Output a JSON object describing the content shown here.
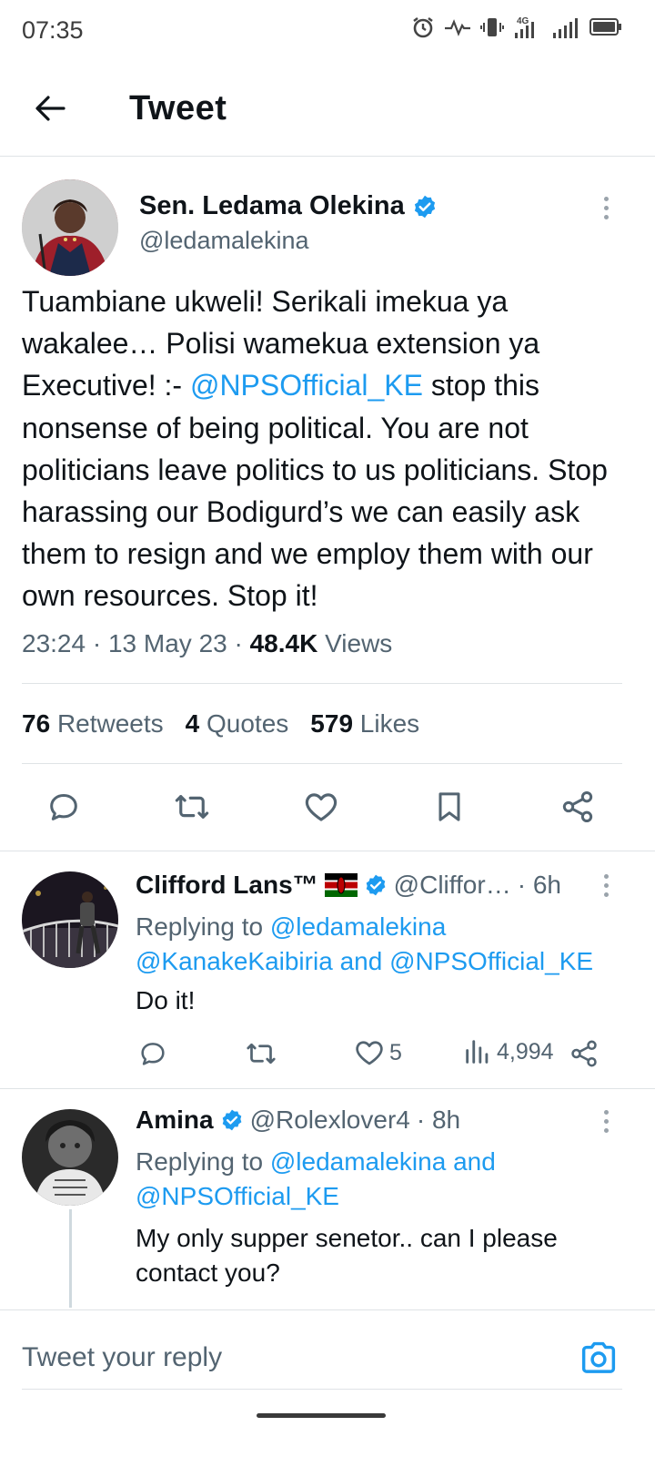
{
  "status_bar": {
    "time": "07:35",
    "network": "4G"
  },
  "header": {
    "title": "Tweet"
  },
  "main_tweet": {
    "display_name": "Sen. Ledama Olekina",
    "handle": "@ledamalekina",
    "text_1": "Tuambiane ukweli! Serikali imekua ya wakalee… Polisi wamekua extension ya Executive! :- ",
    "mention": "@NPSOfficial_KE",
    "text_2": " stop this nonsense of being political. You are not politicians leave politics to us politicians. Stop harassing our Bodigurd’s we can easily ask them to resign and we employ them with our own resources. Stop it!",
    "time": "23:24",
    "date": "13 May 23",
    "separator": "·",
    "views_count": "48.4K",
    "views_label": "Views",
    "retweets_count": "76",
    "retweets_label": "Retweets",
    "quotes_count": "4",
    "quotes_label": "Quotes",
    "likes_count": "579",
    "likes_label": "Likes"
  },
  "replies": [
    {
      "display_name": "Clifford Lans™",
      "flag": "Kenya flag",
      "handle": "@Cliffor…",
      "age": "· 6h",
      "replying_prefix": "Replying to",
      "reply_to_1": "@ledamalekina",
      "reply_to_2": "@KanakeKaibiria",
      "and": "and",
      "reply_to_3": "@NPSOfficial_KE",
      "text": "Do it!",
      "likes": "5",
      "views": "4,994"
    },
    {
      "display_name": "Amina",
      "handle": "@Rolexlover4",
      "age": "· 8h",
      "replying_prefix": "Replying to",
      "reply_to_1": "@ledamalekina",
      "and": "and",
      "reply_to_2": "@NPSOfficial_KE",
      "text": "My only supper senetor.. can I please contact you?"
    }
  ],
  "reply_bar": {
    "placeholder": "Tweet your reply"
  },
  "colors": {
    "accent": "#1d9bf0",
    "text": "#0f1419",
    "muted": "#536471",
    "divider": "#dfe3e6"
  }
}
